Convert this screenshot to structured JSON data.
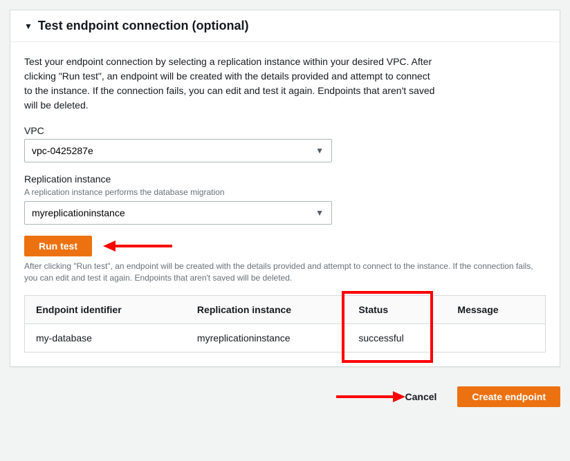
{
  "section": {
    "title": "Test endpoint connection (optional)",
    "description": "Test your endpoint connection by selecting a replication instance within your desired VPC. After clicking \"Run test\", an endpoint will be created with the details provided and attempt to connect to the instance. If the connection fails, you can edit and test it again. Endpoints that aren't saved will be deleted."
  },
  "vpc": {
    "label": "VPC",
    "value": "vpc-0425287e"
  },
  "replication": {
    "label": "Replication instance",
    "hint": "A replication instance performs the database migration",
    "value": "myreplicationinstance"
  },
  "run_test": "Run test",
  "run_test_help": "After clicking \"Run test\", an endpoint will be created with the details provided and attempt to connect to the instance. If the connection fails, you can edit and test it again. Endpoints that aren't saved will be deleted.",
  "table": {
    "headers": {
      "endpoint": "Endpoint identifier",
      "replication": "Replication instance",
      "status": "Status",
      "message": "Message"
    },
    "row": {
      "endpoint": "my-database",
      "replication": "myreplicationinstance",
      "status": "successful",
      "message": ""
    }
  },
  "footer": {
    "cancel": "Cancel",
    "create": "Create endpoint"
  }
}
